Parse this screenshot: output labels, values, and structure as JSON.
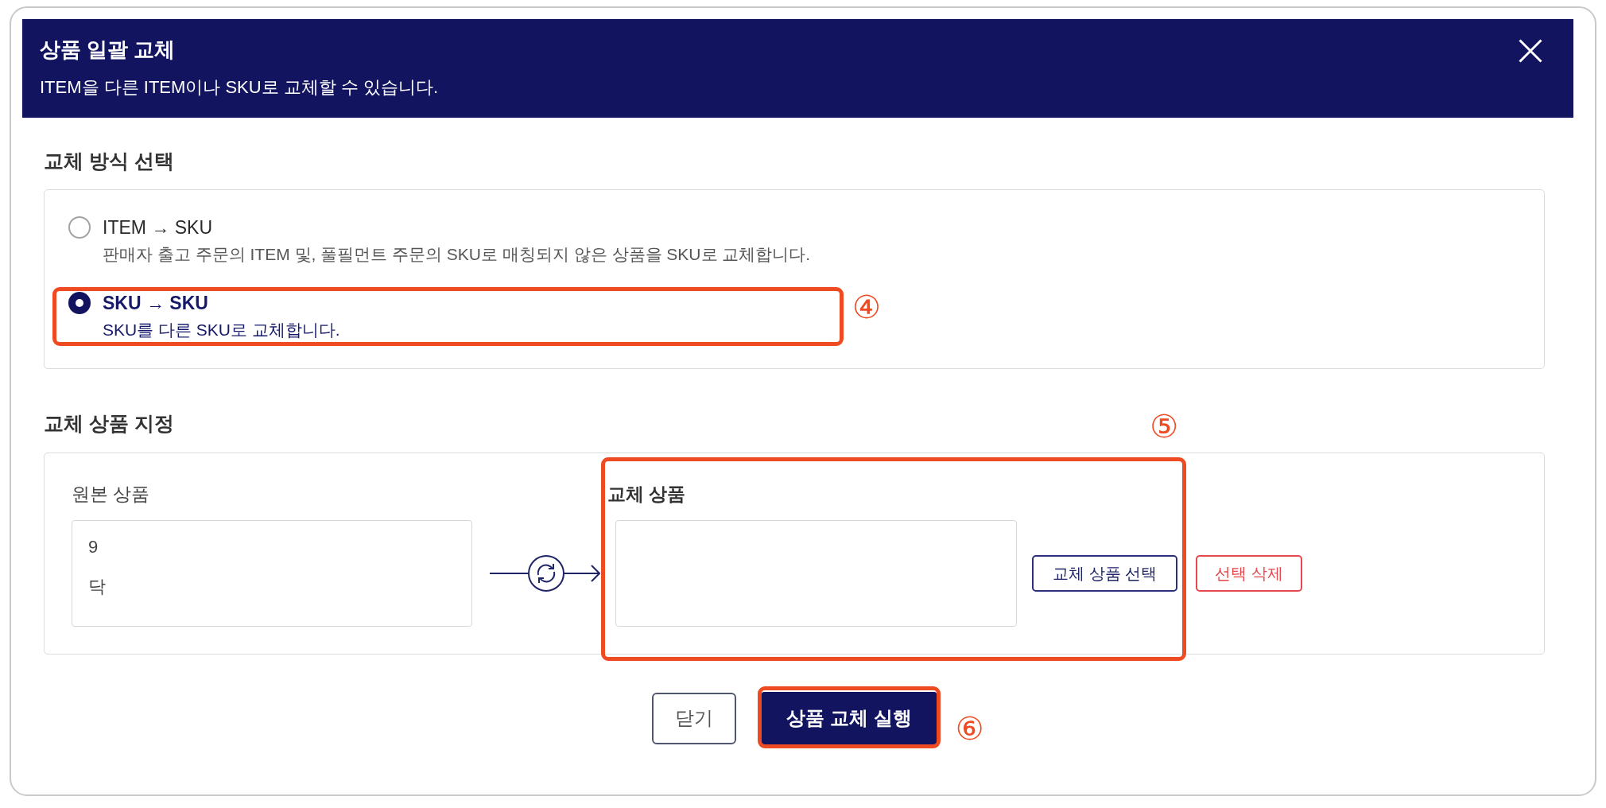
{
  "dialog": {
    "title": "상품 일괄 교체",
    "subtitle": "ITEM을 다른 ITEM이나 SKU로 교체할 수 있습니다."
  },
  "method_section": {
    "heading": "교체 방식 선택",
    "options": [
      {
        "label": "ITEM → SKU",
        "description": "판매자 출고 주문의 ITEM 및, 풀필먼트 주문의 SKU로 매칭되지 않은 상품을 SKU로 교체합니다.",
        "selected": false
      },
      {
        "label": "SKU → SKU",
        "description": "SKU를 다른 SKU로 교체합니다.",
        "selected": true,
        "callout": "④"
      }
    ]
  },
  "product_section": {
    "heading": "교체 상품 지정",
    "source": {
      "label": "원본 상품",
      "lines": [
        "9",
        "닥"
      ]
    },
    "replacement": {
      "label": "교체 상품",
      "select_button": "교체 상품 선택",
      "callout": "⑤"
    },
    "clear_button": "선택 삭제"
  },
  "footer_buttons": [
    {
      "label": "닫기",
      "kind": "secondary"
    },
    {
      "label": "상품 교체 실행",
      "kind": "primary",
      "callout": "⑥"
    }
  ]
}
